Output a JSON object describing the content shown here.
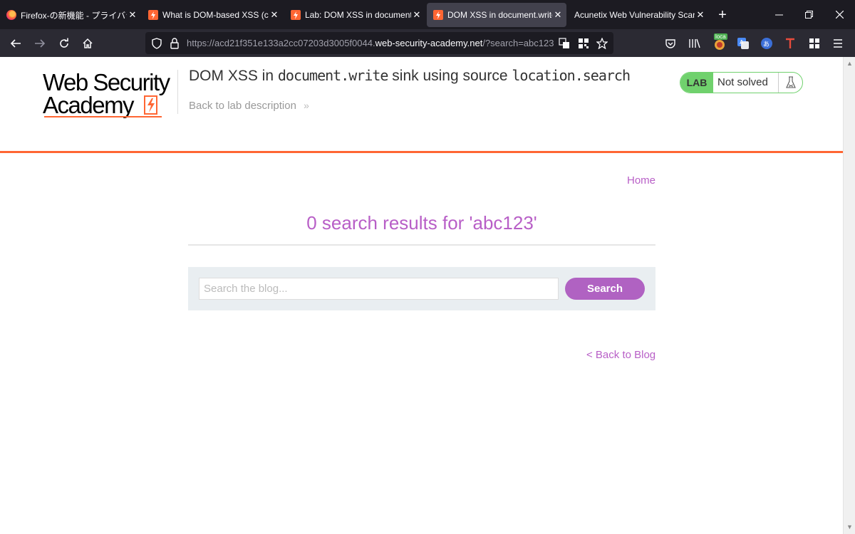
{
  "browser": {
    "tabs": [
      {
        "title": "Firefox-の新機能 - プライバシー保",
        "icon": "firefox-icon"
      },
      {
        "title": "What is DOM-based XSS (cro",
        "icon": "portswigger-icon"
      },
      {
        "title": "Lab: DOM XSS in document.w",
        "icon": "portswigger-icon"
      },
      {
        "title": "DOM XSS in document.write",
        "icon": "portswigger-icon",
        "active": true
      },
      {
        "title": "Acunetix Web Vulnerability Scann"
      }
    ],
    "url": {
      "prefix": "https://acd21f351e133a2cc07203d3005f0044.",
      "domain": "web-security-academy.net",
      "suffix": "/?search=abc123"
    },
    "extension_badge": "loca"
  },
  "header": {
    "logo_line1": "Web Security",
    "logo_line2": "Academy",
    "title_parts": [
      "DOM XSS in ",
      "document.write",
      " sink using source ",
      "location.search"
    ],
    "back_to_description": "Back to lab description",
    "lab_label": "LAB",
    "lab_status": "Not solved"
  },
  "main": {
    "home_link": "Home",
    "results_title": "0 search results for 'abc123'",
    "search_placeholder": "Search the blog...",
    "search_button": "Search",
    "back_to_blog": "< Back to Blog"
  },
  "colors": {
    "accent_orange": "#ff6633",
    "link_purple": "#b85fc7",
    "button_purple": "#b062c2",
    "lab_green": "#70d16d"
  }
}
